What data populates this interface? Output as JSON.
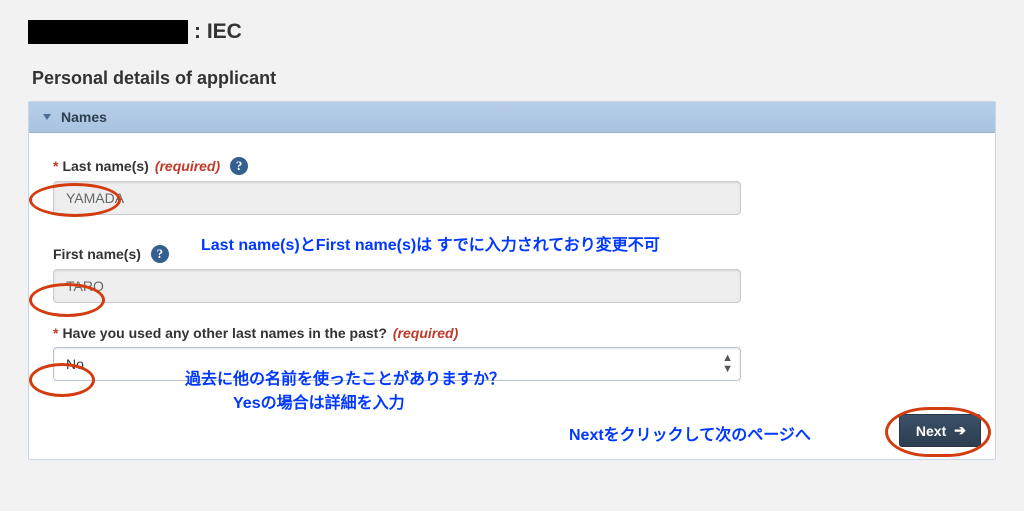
{
  "heading_suffix": ": IEC",
  "subheading": "Personal details of applicant",
  "panel_title": "Names",
  "required_word": "(required)",
  "fields": {
    "last": {
      "label": "Last name(s)",
      "value": "YAMADA",
      "required": true,
      "has_help": true
    },
    "first": {
      "label": "First name(s)",
      "value": "TARO",
      "required": false,
      "has_help": true
    },
    "other_last": {
      "label": "Have you used any other last names in the past?",
      "value": "No",
      "required": true
    }
  },
  "annotations": {
    "names_locked": "Last name(s)とFirst name(s)は すでに入力されており変更不可",
    "past_names_q": "過去に他の名前を使ったことがありますか？",
    "past_names_yes": "Yesの場合は詳細を入力",
    "next_hint": "Nextをクリックして次のページへ"
  },
  "next_label": "Next"
}
